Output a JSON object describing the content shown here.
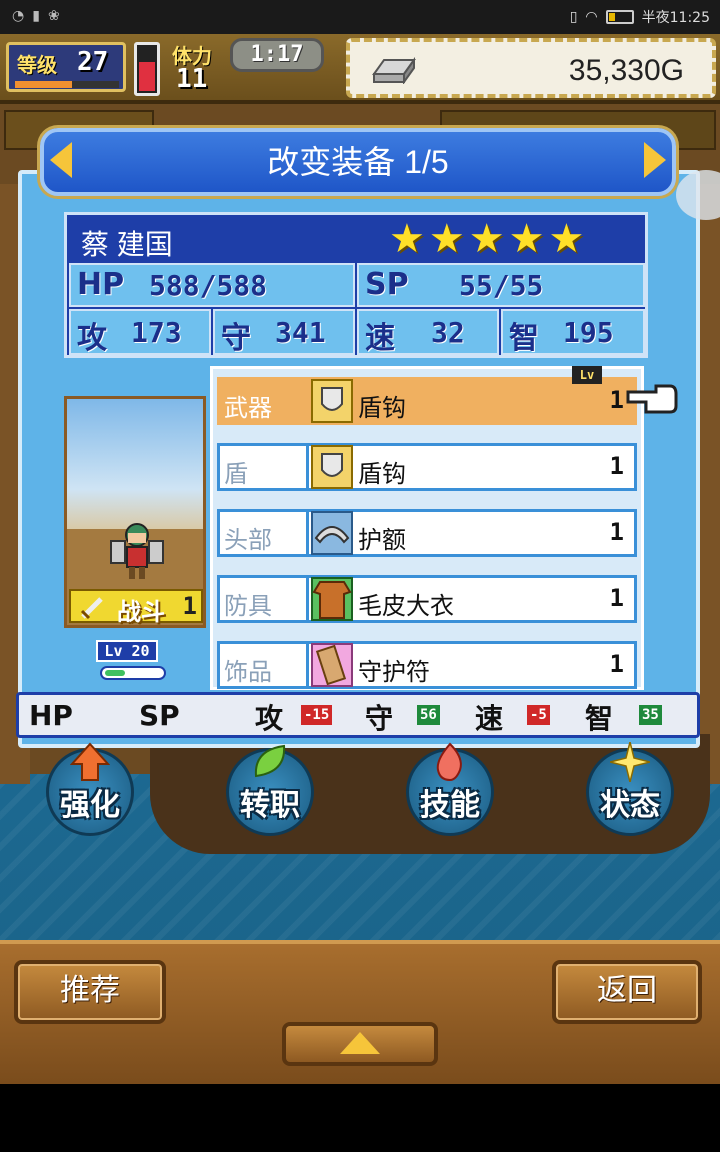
{
  "status_bar": {
    "time": "半夜11:25"
  },
  "hud": {
    "level_label": "等级",
    "level": "27",
    "level_progress": 0.55,
    "stamina_label": "体力",
    "stamina": "11",
    "stamina_fill": 0.65,
    "timer": "1:17",
    "gold": "35,330G"
  },
  "dialog": {
    "title": "改变装备 1/5",
    "character": {
      "name": "蔡 建国",
      "stars": 5,
      "hp_label": "HP",
      "hp": "588/588",
      "sp_label": "SP",
      "sp": "55/55",
      "atk_label": "攻",
      "atk": "173",
      "def_label": "守",
      "def": "341",
      "spd_label": "速",
      "spd": "32",
      "int_label": "智",
      "int": "195"
    },
    "portrait": {
      "role": "战斗",
      "role_level": "1",
      "level_tag": "Lv 20",
      "level_progress": 0.35
    },
    "equipment_lv_header": "Lv",
    "equipment": [
      {
        "slot": "武器",
        "item": "盾钩",
        "lv": "1",
        "selected": true,
        "icon": "shield-icon"
      },
      {
        "slot": "盾",
        "item": "盾钩",
        "lv": "1",
        "selected": false,
        "icon": "shield-icon"
      },
      {
        "slot": "头部",
        "item": "护额",
        "lv": "1",
        "selected": false,
        "icon": "headband-icon"
      },
      {
        "slot": "防具",
        "item": "毛皮大衣",
        "lv": "1",
        "selected": false,
        "icon": "fur-coat-icon"
      },
      {
        "slot": "饰品",
        "item": "守护符",
        "lv": "1",
        "selected": false,
        "icon": "talisman-icon"
      }
    ],
    "diff": {
      "hp_label": "HP",
      "sp_label": "SP",
      "atk_label": "攻",
      "atk": "-15",
      "def_label": "守",
      "def": "56",
      "spd_label": "速",
      "spd": "-5",
      "int_label": "智",
      "int": "35"
    }
  },
  "actions": [
    {
      "label": "强化",
      "icon": "arrow-up-icon"
    },
    {
      "label": "转职",
      "icon": "leaf-icon"
    },
    {
      "label": "技能",
      "icon": "flame-icon"
    },
    {
      "label": "状态",
      "icon": "sparkle-icon"
    }
  ],
  "bottom": {
    "recommend": "推荐",
    "back": "返回"
  },
  "colors": {
    "accent_blue": "#1e3ea8",
    "selected_row": "#f0b060",
    "gold_star": "#ffe028",
    "negative": "#d02828",
    "positive": "#1f8a3c"
  }
}
